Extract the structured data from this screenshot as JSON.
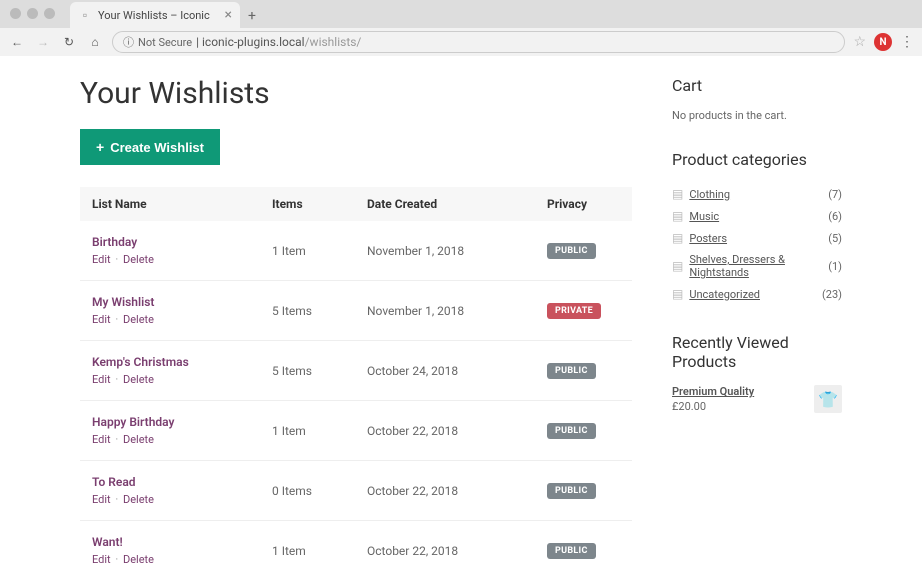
{
  "browser": {
    "tab_title": "Your Wishlists – Iconic",
    "secure_label": "Not Secure",
    "url_host": "iconic-plugins.local",
    "url_path": "/wishlists/"
  },
  "page": {
    "title": "Your Wishlists",
    "create_button": "Create Wishlist"
  },
  "table": {
    "headers": {
      "name": "List Name",
      "items": "Items",
      "date": "Date Created",
      "privacy": "Privacy"
    },
    "actions": {
      "edit": "Edit",
      "delete": "Delete"
    },
    "rows": [
      {
        "name": "Birthday",
        "items": "1 Item",
        "date": "November 1, 2018",
        "privacy": "PUBLIC",
        "privacy_type": "public"
      },
      {
        "name": "My Wishlist",
        "items": "5 Items",
        "date": "November 1, 2018",
        "privacy": "PRIVATE",
        "privacy_type": "private"
      },
      {
        "name": "Kemp's Christmas",
        "items": "5 Items",
        "date": "October 24, 2018",
        "privacy": "PUBLIC",
        "privacy_type": "public"
      },
      {
        "name": "Happy Birthday",
        "items": "1 Item",
        "date": "October 22, 2018",
        "privacy": "PUBLIC",
        "privacy_type": "public"
      },
      {
        "name": "To Read",
        "items": "0 Items",
        "date": "October 22, 2018",
        "privacy": "PUBLIC",
        "privacy_type": "public"
      },
      {
        "name": "Want!",
        "items": "1 Item",
        "date": "October 22, 2018",
        "privacy": "PUBLIC",
        "privacy_type": "public"
      }
    ]
  },
  "sidebar": {
    "cart": {
      "title": "Cart",
      "empty": "No products in the cart."
    },
    "categories": {
      "title": "Product categories",
      "items": [
        {
          "label": "Clothing",
          "count": "(7)"
        },
        {
          "label": "Music",
          "count": "(6)"
        },
        {
          "label": "Posters",
          "count": "(5)"
        },
        {
          "label": "Shelves, Dressers & Nightstands",
          "count": "(1)"
        },
        {
          "label": "Uncategorized",
          "count": "(23)"
        }
      ]
    },
    "recent": {
      "title": "Recently Viewed Products",
      "product": {
        "name": "Premium Quality",
        "price": "£20.00"
      }
    }
  }
}
